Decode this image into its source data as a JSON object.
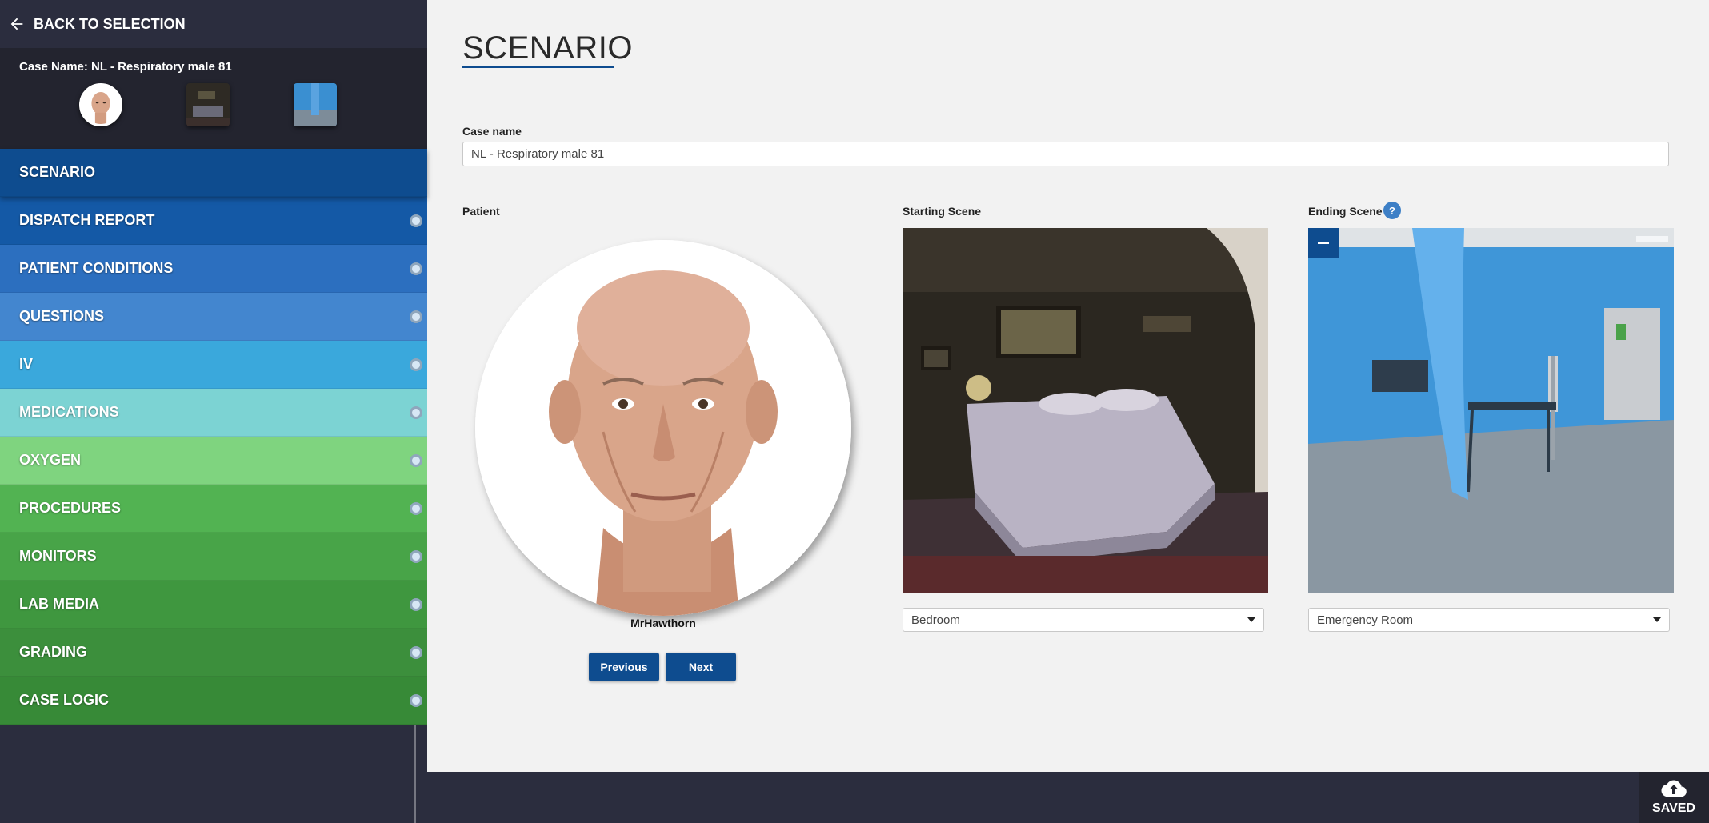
{
  "sidebar": {
    "back_label": "BACK TO SELECTION",
    "case_title": "Case Name: NL - Respiratory male 81",
    "nav": [
      {
        "label": "SCENARIO",
        "color": "#0e4c8f"
      },
      {
        "label": "DISPATCH REPORT",
        "color": "#1459a6"
      },
      {
        "label": "PATIENT CONDITIONS",
        "color": "#2c6fbf"
      },
      {
        "label": "QUESTIONS",
        "color": "#4386cf"
      },
      {
        "label": "IV",
        "color": "#3aa8dc"
      },
      {
        "label": "MEDICATIONS",
        "color": "#7cd3d3"
      },
      {
        "label": "OXYGEN",
        "color": "#7fd47f"
      },
      {
        "label": "PROCEDURES",
        "color": "#52b352"
      },
      {
        "label": "MONITORS",
        "color": "#48a448"
      },
      {
        "label": "LAB MEDIA",
        "color": "#3f973f"
      },
      {
        "label": "GRADING",
        "color": "#3c8f3c"
      },
      {
        "label": "CASE LOGIC",
        "color": "#378a37"
      }
    ]
  },
  "main": {
    "title": "SCENARIO",
    "case_name_label": "Case name",
    "case_name_value": "NL - Respiratory male 81",
    "patient_label": "Patient",
    "patient_name": "MrHawthorn",
    "prev_label": "Previous",
    "next_label": "Next",
    "starting_scene_label": "Starting Scene",
    "starting_scene_value": "Bedroom",
    "ending_scene_label": "Ending Scene",
    "ending_scene_value": "Emergency Room",
    "help_glyph": "?"
  },
  "footer": {
    "save_label": "SAVED"
  },
  "colors": {
    "accent": "#0e4c8f",
    "sidebar_bg": "#2b2d3e",
    "content_bg": "#f2f2f2"
  }
}
